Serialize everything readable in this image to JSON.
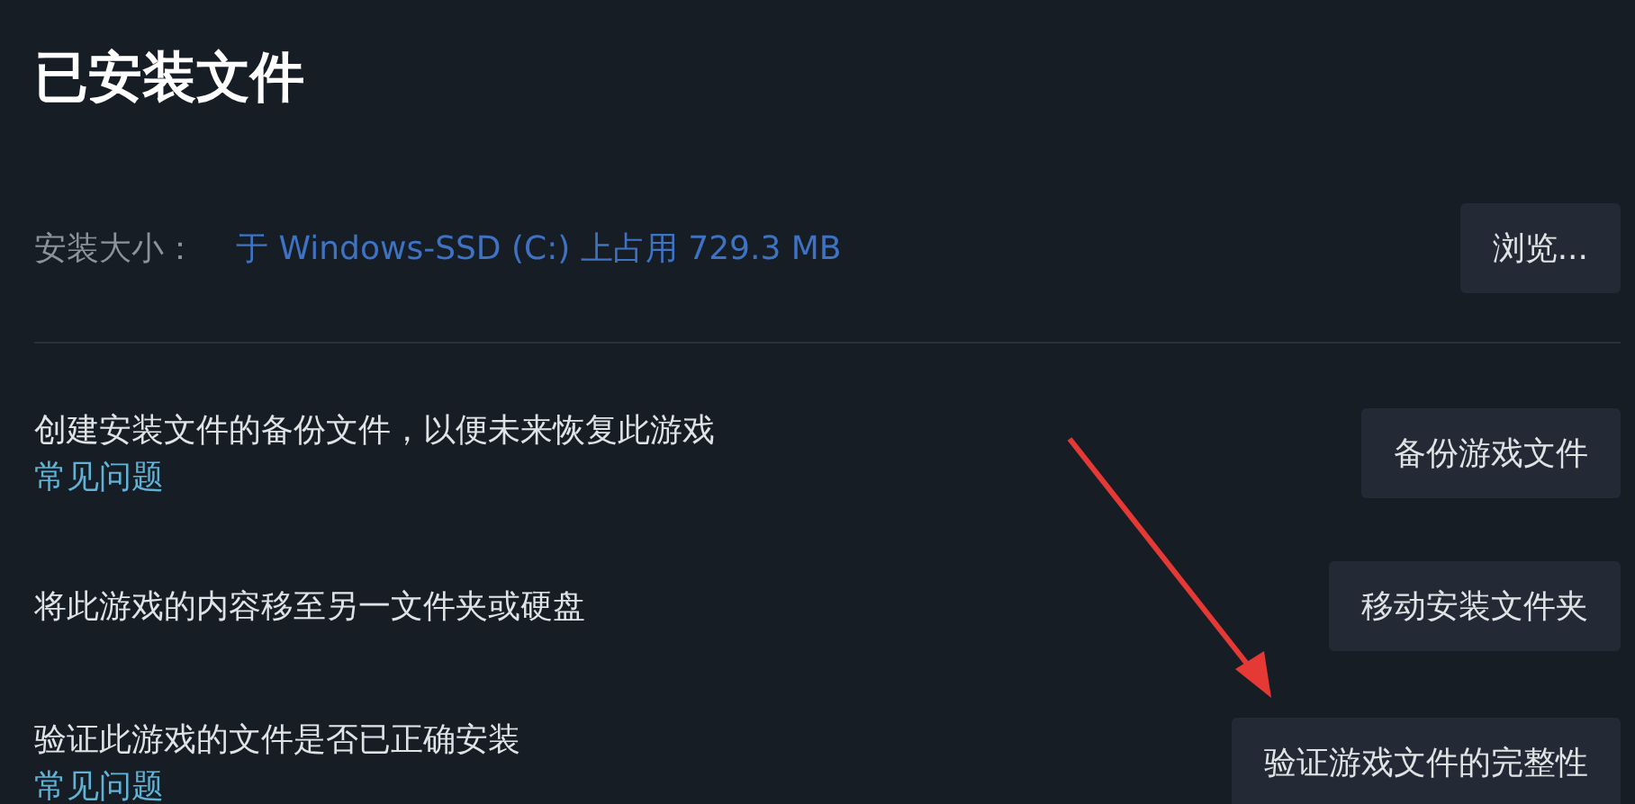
{
  "title": "已安装文件",
  "install_size": {
    "label": "安装大小：",
    "value": "于 Windows-SSD (C:) 上占用 729.3 MB",
    "button": "浏览..."
  },
  "actions": [
    {
      "description": "创建安装文件的备份文件，以便未来恢复此游戏",
      "link": "常见问题",
      "button": "备份游戏文件"
    },
    {
      "description": "将此游戏的内容移至另一文件夹或硬盘",
      "button": "移动安装文件夹"
    },
    {
      "description": "验证此游戏的文件是否已正确安装",
      "link": "常见问题",
      "button": "验证游戏文件的完整性"
    }
  ]
}
